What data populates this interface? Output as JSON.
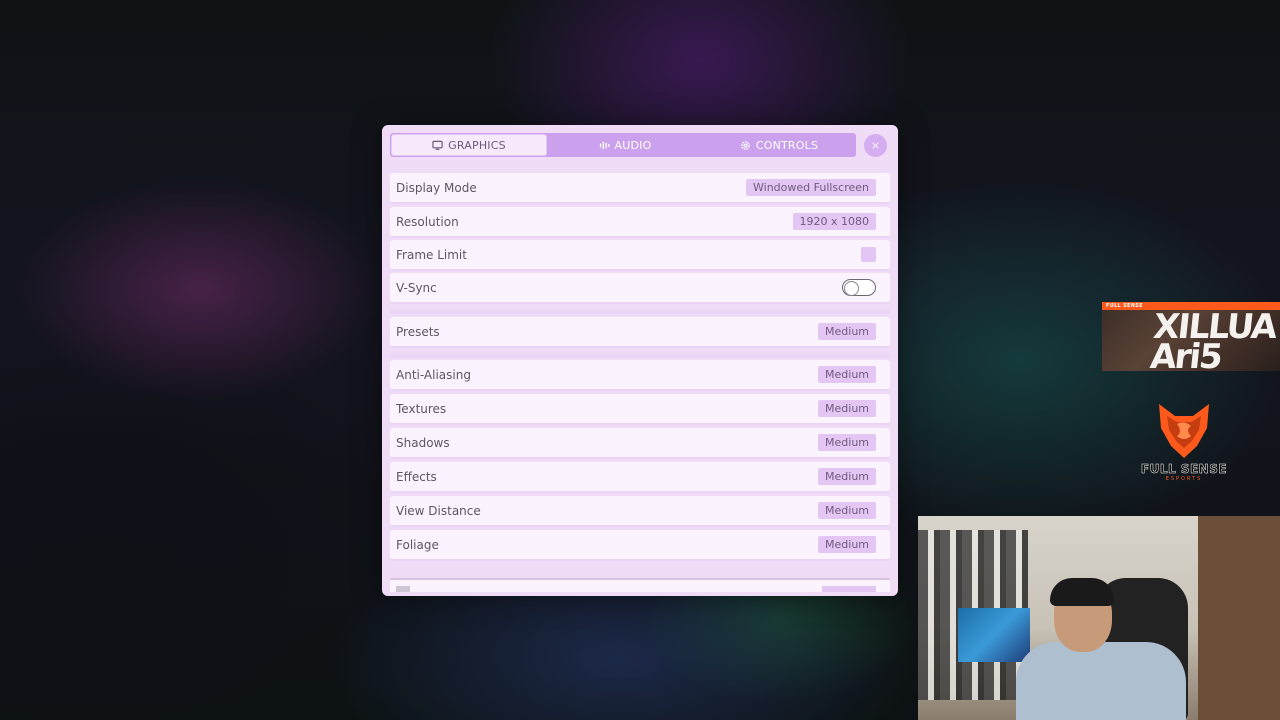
{
  "tabs": [
    {
      "label": "GRAPHICS",
      "icon": "monitor-icon",
      "active": true
    },
    {
      "label": "AUDIO",
      "icon": "audio-wave-icon",
      "active": false
    },
    {
      "label": "CONTROLS",
      "icon": "gear-icon",
      "active": false
    }
  ],
  "close_symbol": "×",
  "settings": {
    "display_mode": {
      "label": "Display Mode",
      "value": "Windowed Fullscreen"
    },
    "resolution": {
      "label": "Resolution",
      "value": "1920 x 1080"
    },
    "frame_limit": {
      "label": "Frame Limit"
    },
    "vsync": {
      "label": "V-Sync",
      "enabled": false
    },
    "presets": {
      "label": "Presets",
      "value": "Medium"
    },
    "anti_aliasing": {
      "label": "Anti-Aliasing",
      "value": "Medium"
    },
    "textures": {
      "label": "Textures",
      "value": "Medium"
    },
    "shadows": {
      "label": "Shadows",
      "value": "Medium"
    },
    "effects": {
      "label": "Effects",
      "value": "Medium"
    },
    "view_distance": {
      "label": "View Distance",
      "value": "Medium"
    },
    "foliage": {
      "label": "Foliage",
      "value": "Medium"
    }
  },
  "overlay": {
    "small_cam_banner": "FULL SENSE",
    "small_cam_text": "XILLUA Ari5",
    "logo_title": "FULL SENSE",
    "logo_subtitle": "ESPORTS"
  },
  "colors": {
    "modal_bg": "#f1dcf8",
    "tabbar": "#cba0ec",
    "value_chip": "#e4c6f4",
    "brand_orange": "#ff5a1c"
  }
}
